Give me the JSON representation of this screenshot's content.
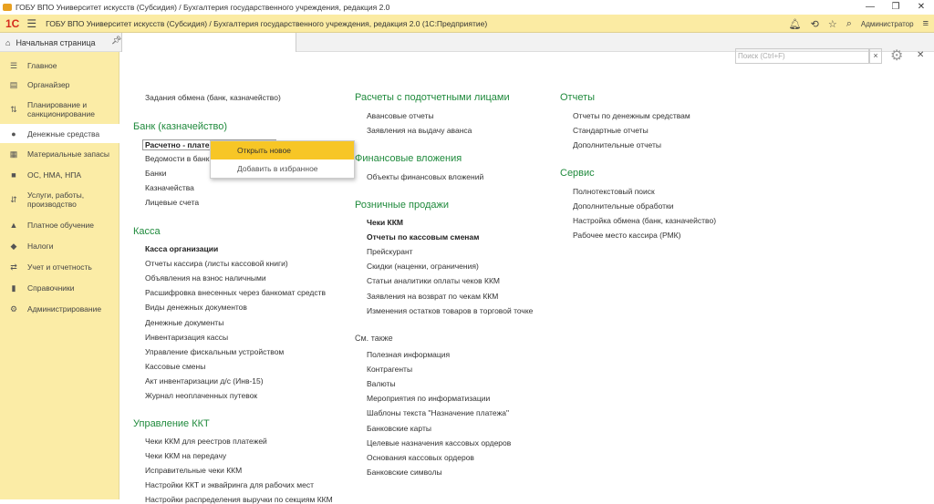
{
  "window": {
    "title": "ГОБУ ВПО Университет искусств (Субсидия) / Бухгалтерия государственного учреждения, редакция 2.0",
    "controls": [
      "—",
      "❐",
      "✕"
    ]
  },
  "header": {
    "brand": "1С",
    "title": "ГОБУ ВПО Университет искусств (Субсидия) / Бухгалтерия государственного учреждения, редакция 2.0  (1С:Предприятие)",
    "user": "Администратор"
  },
  "tabs": {
    "home": "Начальная страница"
  },
  "sidebar": {
    "items": [
      {
        "label": "Главное",
        "icon": "☰"
      },
      {
        "label": "Органайзер",
        "icon": "▤"
      },
      {
        "label": "Планирование и санкционирование",
        "icon": "⇅"
      },
      {
        "label": "Денежные средства",
        "icon": "●"
      },
      {
        "label": "Материальные запасы",
        "icon": "▦"
      },
      {
        "label": "ОС, НМА, НПА",
        "icon": "■"
      },
      {
        "label": "Услуги, работы, производство",
        "icon": "⇵"
      },
      {
        "label": "Платное обучение",
        "icon": "▲"
      },
      {
        "label": "Налоги",
        "icon": "◆"
      },
      {
        "label": "Учет и отчетность",
        "icon": "⇄"
      },
      {
        "label": "Справочники",
        "icon": "▮"
      },
      {
        "label": "Администрирование",
        "icon": "⚙"
      }
    ]
  },
  "search": {
    "placeholder": "Поиск (Ctrl+F)"
  },
  "col1": {
    "top": "Задания обмена (банк, казначейство)",
    "bank": {
      "title": "Банк (казначейство)",
      "items": [
        "Расчетно - плате",
        "Ведомости в банк",
        "Банки",
        "Казначейства",
        "Лицевые счета"
      ]
    },
    "kassa": {
      "title": "Касса",
      "items": [
        "Касса организации",
        "Отчеты кассира (листы кассовой книги)",
        "Объявления на взнос наличными",
        "Расшифровка внесенных через банкомат средств",
        "Виды денежных документов",
        "Денежные документы",
        "Инвентаризация кассы",
        "Управление фискальным устройством",
        "Кассовые смены",
        "Акт инвентаризации д/с (Инв-15)",
        "Журнал неоплаченных путевок"
      ]
    },
    "kkt": {
      "title": "Управление ККТ",
      "items": [
        "Чеки ККМ для реестров платежей",
        "Чеки ККМ на передачу",
        "Исправительные чеки ККМ",
        "Настройки ККТ и эквайринга для рабочих мест",
        "Настройки распределения выручки по секциям ККМ"
      ]
    }
  },
  "col2": {
    "podot": {
      "title": "Расчеты с подотчетными лицами",
      "items": [
        "Авансовые отчеты",
        "Заявления на выдачу аванса"
      ]
    },
    "fin": {
      "title": "Финансовые вложения",
      "items": [
        "Объекты финансовых вложений"
      ]
    },
    "retail": {
      "title": "Розничные продажи",
      "items": [
        "Чеки ККМ",
        "Отчеты по кассовым сменам",
        "Прейскурант",
        "Скидки (наценки, ограничения)",
        "Статьи аналитики оплаты чеков ККМ",
        "Заявления на возврат по чекам ККМ",
        "Изменения остатков товаров в торговой точке"
      ]
    },
    "see": {
      "title": "См. также",
      "items": [
        "Полезная информация",
        "Контрагенты",
        "Валюты",
        "Мероприятия по информатизации",
        "Шаблоны текста \"Назначение платежа\"",
        "Банковские карты",
        "Целевые назначения кассовых ордеров",
        "Основания кассовых ордеров",
        "Банковские символы"
      ]
    }
  },
  "col3": {
    "reports": {
      "title": "Отчеты",
      "items": [
        "Отчеты по денежным средствам",
        "Стандартные отчеты",
        "Дополнительные отчеты"
      ]
    },
    "service": {
      "title": "Сервис",
      "items": [
        "Полнотекстовый поиск",
        "Дополнительные обработки",
        "Настройка обмена (банк, казначейство)",
        "Рабочее место кассира (РМК)"
      ]
    }
  },
  "context_menu": {
    "items": [
      "Открыть новое",
      "Добавить в избранное"
    ]
  }
}
